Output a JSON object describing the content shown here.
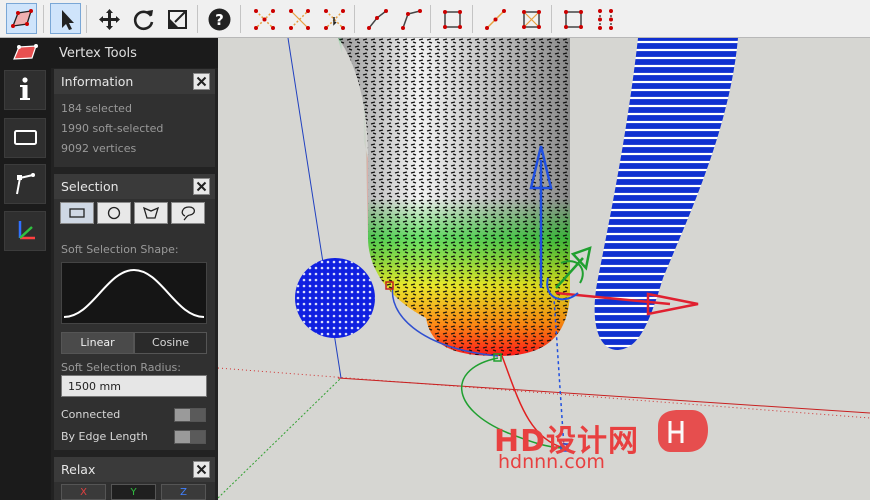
{
  "panel": {
    "title": "Vertex Tools",
    "collapse_glyph": "‹"
  },
  "information": {
    "title": "Information",
    "selected": "184 selected",
    "soft_selected": "1990 soft-selected",
    "vertices": "9092 vertices"
  },
  "selection": {
    "title": "Selection",
    "shape_buttons": [
      "rectangle-select",
      "circle-select",
      "lasso-polygon-select",
      "lasso-freehand-select"
    ],
    "soft_shape_label": "Soft Selection Shape:",
    "falloff_linear": "Linear",
    "falloff_cosine": "Cosine",
    "radius_label": "Soft Selection Radius:",
    "radius_value": "1500 mm",
    "connected_label": "Connected",
    "by_edge_label": "By Edge Length"
  },
  "relax": {
    "title": "Relax",
    "x": "X",
    "y": "Y",
    "z": "Z"
  },
  "watermark": {
    "brand": "HD设计网",
    "url": "hdnnn.com"
  },
  "colors": {
    "accent": "#cfe4fb",
    "panel_bg": "#222222",
    "axis_x": "#e0303a",
    "axis_y": "#22a030",
    "axis_z": "#2050d0"
  }
}
